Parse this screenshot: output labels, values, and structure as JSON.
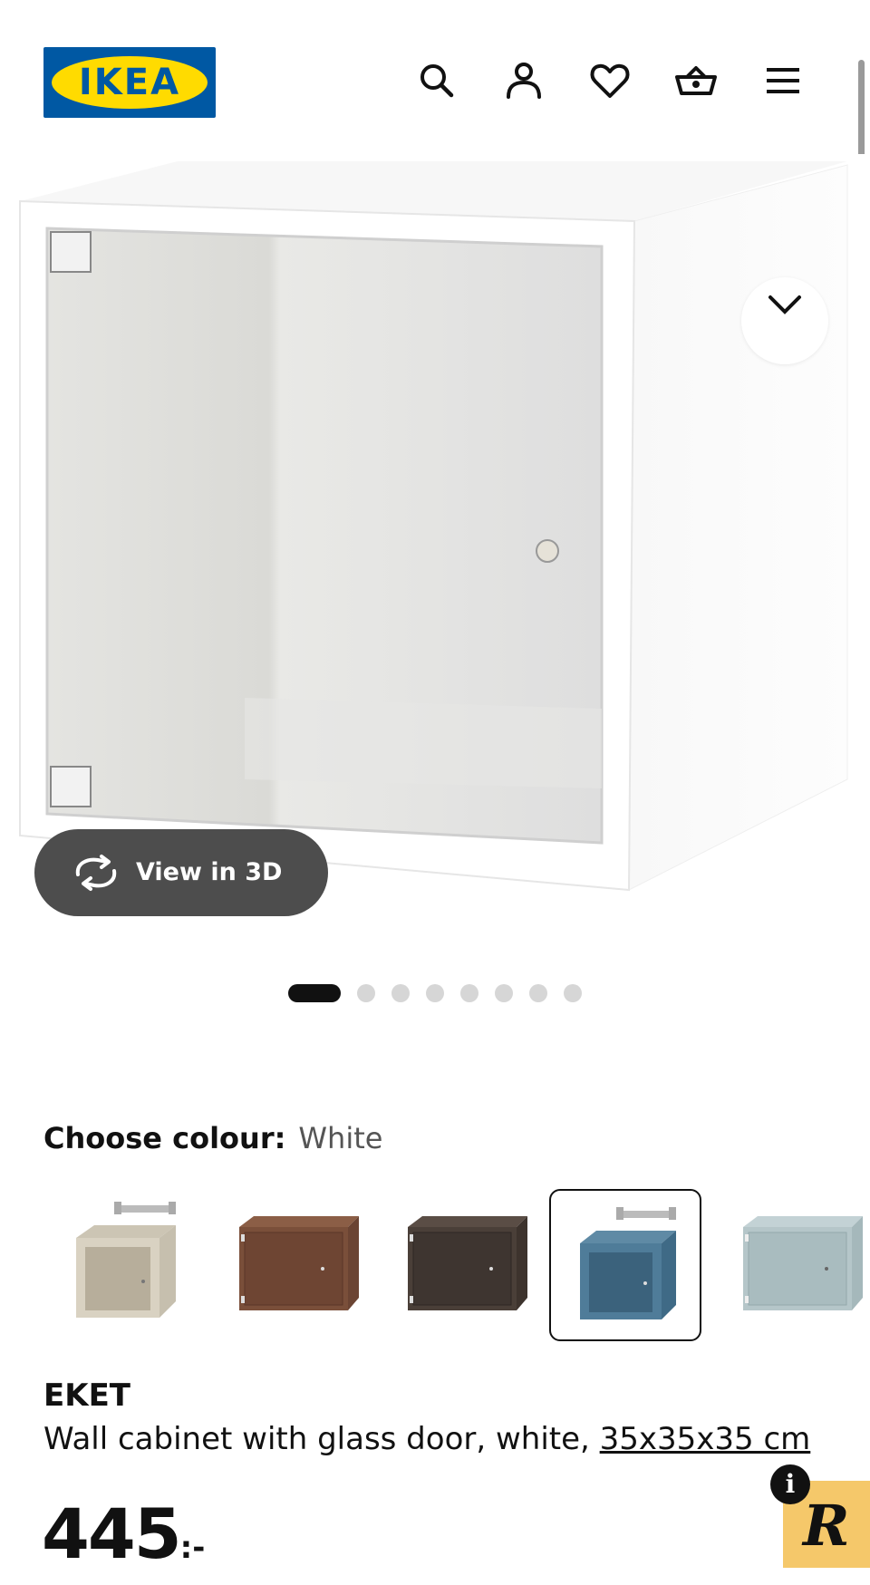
{
  "header": {
    "logo_text": "IKEA",
    "icons": [
      "search-icon",
      "profile-icon",
      "heart-icon",
      "basket-icon",
      "menu-icon"
    ]
  },
  "gallery": {
    "view_3d_label": "View in 3D",
    "slide_count": 8,
    "active_slide": 1
  },
  "colour": {
    "label": "Choose colour:",
    "selected": "White",
    "swatches": [
      {
        "name": "beige",
        "color": "#d9d2c2",
        "has_bracket": true
      },
      {
        "name": "walnut",
        "color": "#7a4f3a",
        "has_bracket": false
      },
      {
        "name": "dark-brown",
        "color": "#4a3f38",
        "has_bracket": false
      },
      {
        "name": "blue",
        "color": "#4f7c99",
        "has_bracket": true,
        "selected": true
      },
      {
        "name": "light-grey-blue",
        "color": "#b5c6c9",
        "has_bracket": false
      }
    ]
  },
  "product": {
    "name": "EKET",
    "description": "Wall cabinet with glass door, white,",
    "size": "35x35x35 cm",
    "price": "445",
    "price_suffix": ":-"
  },
  "badge": {
    "letter": "R",
    "info": "i",
    "color": "#f5c86a"
  },
  "colors": {
    "ikea_blue": "#0058a3",
    "ikea_yellow": "#ffdb00",
    "pill_bg": "#4d4d4d"
  }
}
